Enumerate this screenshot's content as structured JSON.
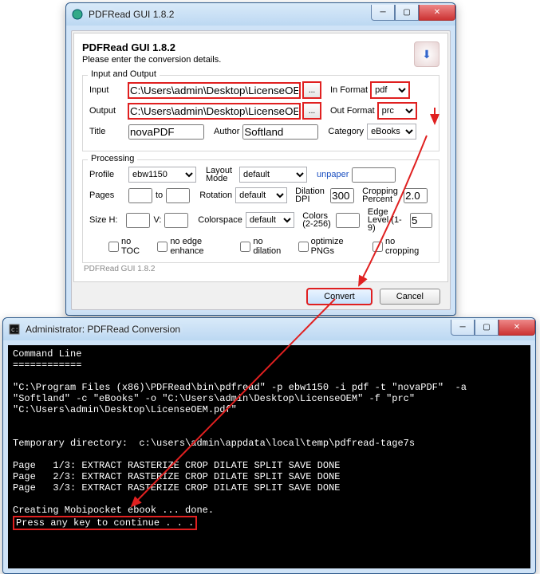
{
  "gui_window": {
    "title": "PDFRead GUI 1.8.2",
    "header_title": "PDFRead GUI 1.8.2",
    "header_sub": "Please enter the conversion details.",
    "groups": {
      "io_title": "Input and Output",
      "proc_title": "Processing"
    },
    "labels": {
      "input": "Input",
      "output": "Output",
      "in_format": "In Format",
      "out_format": "Out Format",
      "title": "Title",
      "author": "Author",
      "category": "Category",
      "profile": "Profile",
      "layout_mode": "Layout\nMode",
      "unpaper": "unpaper",
      "pages": "Pages",
      "to": "to",
      "rotation": "Rotation",
      "dilation_dpi": "Dilation\nDPI",
      "cropping_pct": "Cropping\nPercent",
      "sizeh": "Size H:",
      "v": "V:",
      "colorspace": "Colorspace",
      "colors": "Colors\n(2-256)",
      "edge_level": "Edge\nLevel (1-9)"
    },
    "fields": {
      "input_path": "C:\\Users\\admin\\Desktop\\LicenseOEM.pdf",
      "output_path": "C:\\Users\\admin\\Desktop\\LicenseOEM",
      "in_format": "pdf",
      "out_format": "prc",
      "title": "novaPDF",
      "author": "Softland",
      "category": "eBooks",
      "profile": "ebw1150",
      "layout_mode": "default",
      "unpaper": "",
      "pages_from": "",
      "pages_to": "",
      "rotation": "default",
      "dilation_dpi": "300",
      "cropping_pct": "2.0",
      "size_h": "",
      "size_v": "",
      "colorspace": "default",
      "colors": "",
      "edge_level": "5"
    },
    "browse_label": "...",
    "checkboxes": {
      "no_toc": "no TOC",
      "no_edge": "no edge enhance",
      "no_dilation": "no dilation",
      "optimize_png": "optimize PNGs",
      "no_cropping": "no cropping"
    },
    "status": "PDFRead GUI 1.8.2",
    "buttons": {
      "convert": "Convert",
      "cancel": "Cancel"
    }
  },
  "console_window": {
    "title": "Administrator:  PDFRead Conversion",
    "lines": [
      "Command Line",
      "============",
      "",
      "\"C:\\Program Files (x86)\\PDFRead\\bin\\pdfread\" -p ebw1150 -i pdf -t \"novaPDF\"  -a \"Softland\" -c \"eBooks\" -o \"C:\\Users\\admin\\Desktop\\LicenseOEM\" -f \"prc\" \"C:\\Users\\admin\\Desktop\\LicenseOEM.pdf\"",
      "",
      "",
      "Temporary directory:  c:\\users\\admin\\appdata\\local\\temp\\pdfread-tage7s",
      "",
      "Page   1/3: EXTRACT RASTERIZE CROP DILATE SPLIT SAVE DONE",
      "Page   2/3: EXTRACT RASTERIZE CROP DILATE SPLIT SAVE DONE",
      "Page   3/3: EXTRACT RASTERIZE CROP DILATE SPLIT SAVE DONE",
      "",
      "Creating Mobipocket ebook ... done."
    ],
    "prompt": "Press any key to continue . . ."
  }
}
